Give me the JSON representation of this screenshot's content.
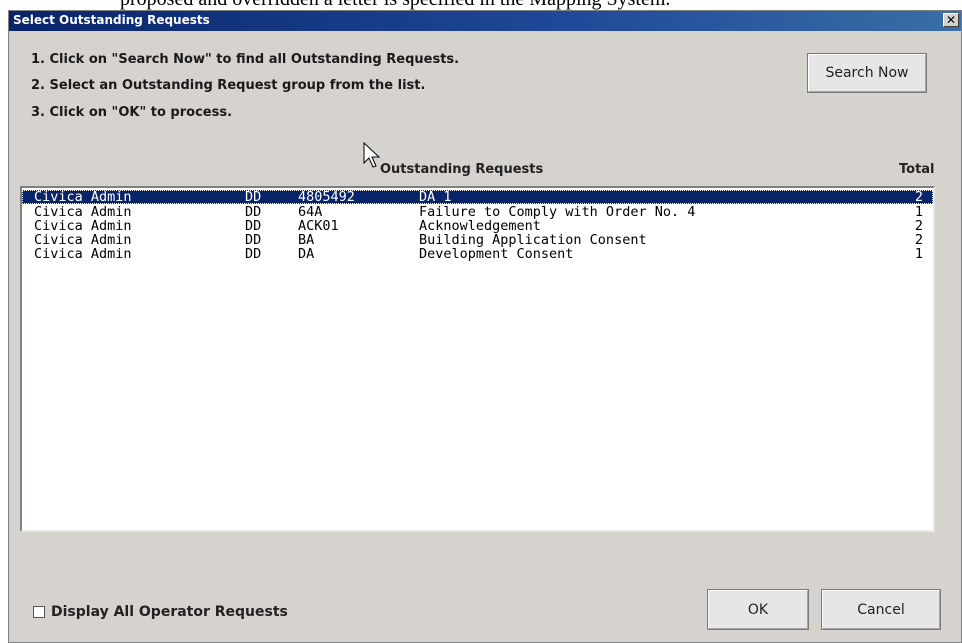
{
  "background_doc_text": "proposed and overridden a letter is specified in the Mapping System.",
  "window": {
    "title": "Select Outstanding Requests",
    "close_label": "✕"
  },
  "instructions": [
    "1. Click on \"Search Now\" to find all Outstanding Requests.",
    "2. Select an Outstanding Request group from the list.",
    "3. Click on \"OK\" to process."
  ],
  "search_button_label": "Search Now",
  "list": {
    "header": "Outstanding Requests",
    "total_header": "Total",
    "selected_index": 0,
    "rows": [
      {
        "operator": "Civica Admin",
        "type": "DD",
        "code": "4805492",
        "description": "DA 1",
        "total": "2"
      },
      {
        "operator": "Civica Admin",
        "type": "DD",
        "code": "64A",
        "description": "Failure to Comply with Order No. 4",
        "total": "1"
      },
      {
        "operator": "Civica Admin",
        "type": "DD",
        "code": "ACK01",
        "description": "Acknowledgement",
        "total": "2"
      },
      {
        "operator": "Civica Admin",
        "type": "DD",
        "code": "BA",
        "description": "Building Application Consent",
        "total": "2"
      },
      {
        "operator": "Civica Admin",
        "type": "DD",
        "code": "DA",
        "description": "Development Consent",
        "total": "1"
      }
    ]
  },
  "display_all_checkbox": {
    "label": "Display All Operator Requests",
    "checked": false
  },
  "ok_label": "OK",
  "cancel_label": "Cancel",
  "colors": {
    "titlebar": "#0a246a",
    "selection": "#0a246a",
    "dialog_bg": "#d6d3ce"
  }
}
